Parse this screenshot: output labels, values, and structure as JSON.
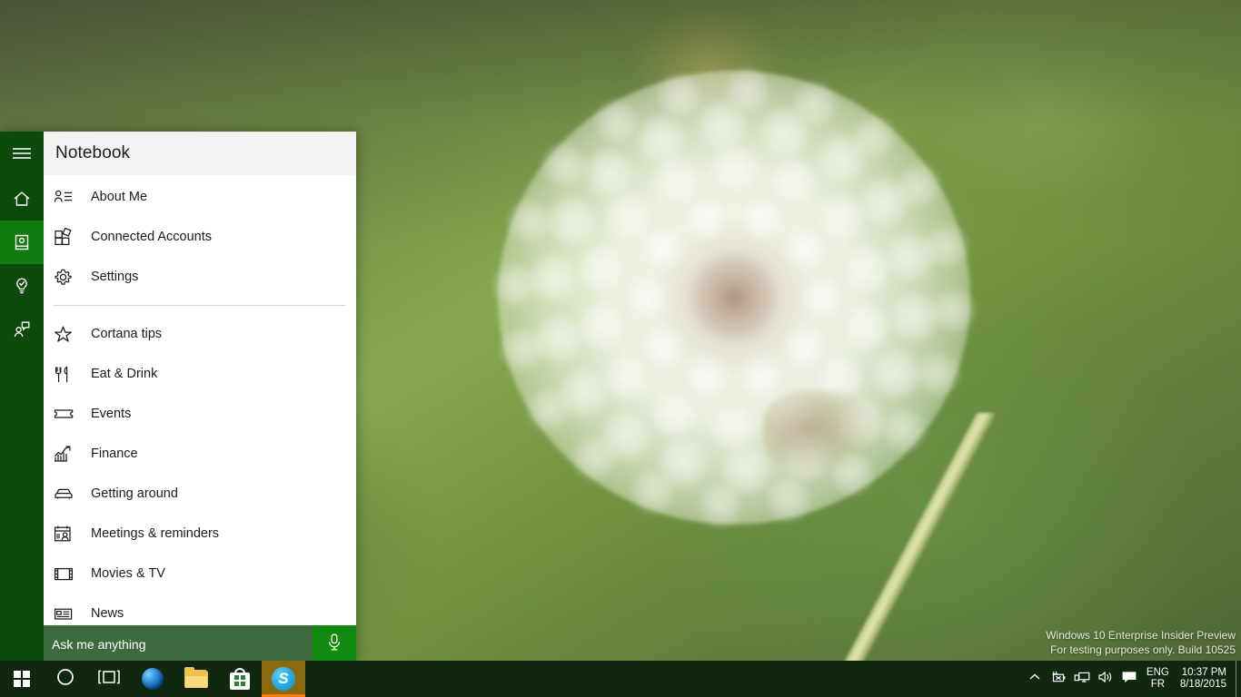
{
  "desktop": {
    "wallpaper_description": "blurred dandelion seed head on green background",
    "accent_green": "#107c10",
    "rail_green": "#0c4a0c",
    "search_green": "#3d6b3d",
    "taskbar_color": "#102710"
  },
  "cortana": {
    "rail": [
      {
        "name": "hamburger-menu",
        "icon": "hamburger-icon",
        "active": false
      },
      {
        "name": "home",
        "icon": "home-icon",
        "active": false
      },
      {
        "name": "notebook",
        "icon": "notebook-icon",
        "active": true
      },
      {
        "name": "reminders",
        "icon": "lightbulb-check-icon",
        "active": false
      },
      {
        "name": "feedback",
        "icon": "person-speech-icon",
        "active": false
      }
    ],
    "header": {
      "title": "Notebook"
    },
    "notebook_items": [
      {
        "label": "About Me",
        "icon": "person-list-icon"
      },
      {
        "label": "Connected Accounts",
        "icon": "accounts-grid-icon"
      },
      {
        "label": "Settings",
        "icon": "gear-icon"
      },
      {
        "label": "Cortana tips",
        "icon": "star-icon"
      },
      {
        "label": "Eat & Drink",
        "icon": "fork-knife-icon"
      },
      {
        "label": "Events",
        "icon": "ticket-icon"
      },
      {
        "label": "Finance",
        "icon": "chart-arrow-icon"
      },
      {
        "label": "Getting around",
        "icon": "car-icon"
      },
      {
        "label": "Meetings & reminders",
        "icon": "calendar-person-icon"
      },
      {
        "label": "Movies & TV",
        "icon": "film-strip-icon"
      },
      {
        "label": "News",
        "icon": "newspaper-icon"
      }
    ],
    "divider_after_index": 2,
    "search": {
      "placeholder": "Ask me anything",
      "value": "",
      "mic_icon": "microphone-icon"
    }
  },
  "watermark": {
    "line1": "Windows 10 Enterprise Insider Preview",
    "line2": "For testing purposes only. Build 10525"
  },
  "taskbar": {
    "buttons": [
      {
        "name": "start",
        "icon": "windows-logo-icon",
        "label": "Start",
        "active": false
      },
      {
        "name": "cortana-search",
        "icon": "circle-icon",
        "label": "Cortana",
        "active": false
      },
      {
        "name": "task-view",
        "icon": "task-view-icon",
        "label": "Task View",
        "active": false
      },
      {
        "name": "edge",
        "icon": "edge-icon",
        "label": "Microsoft Edge",
        "active": false
      },
      {
        "name": "file-explorer",
        "icon": "folder-icon",
        "label": "File Explorer",
        "active": false
      },
      {
        "name": "store",
        "icon": "store-bag-icon",
        "label": "Store",
        "active": false
      },
      {
        "name": "skype",
        "icon": "skype-icon",
        "label": "Skype",
        "active": true,
        "glyph": "S"
      }
    ],
    "tray": {
      "icons": [
        {
          "name": "show-hidden-icons",
          "icon": "chevron-up-icon"
        },
        {
          "name": "battery",
          "icon": "battery-x-icon"
        },
        {
          "name": "network",
          "icon": "network-monitor-icon"
        },
        {
          "name": "volume",
          "icon": "speaker-icon"
        },
        {
          "name": "action-center",
          "icon": "action-center-icon"
        }
      ],
      "language_line1": "ENG",
      "language_line2": "FR",
      "time": "10:37 PM",
      "date": "8/18/2015"
    }
  }
}
